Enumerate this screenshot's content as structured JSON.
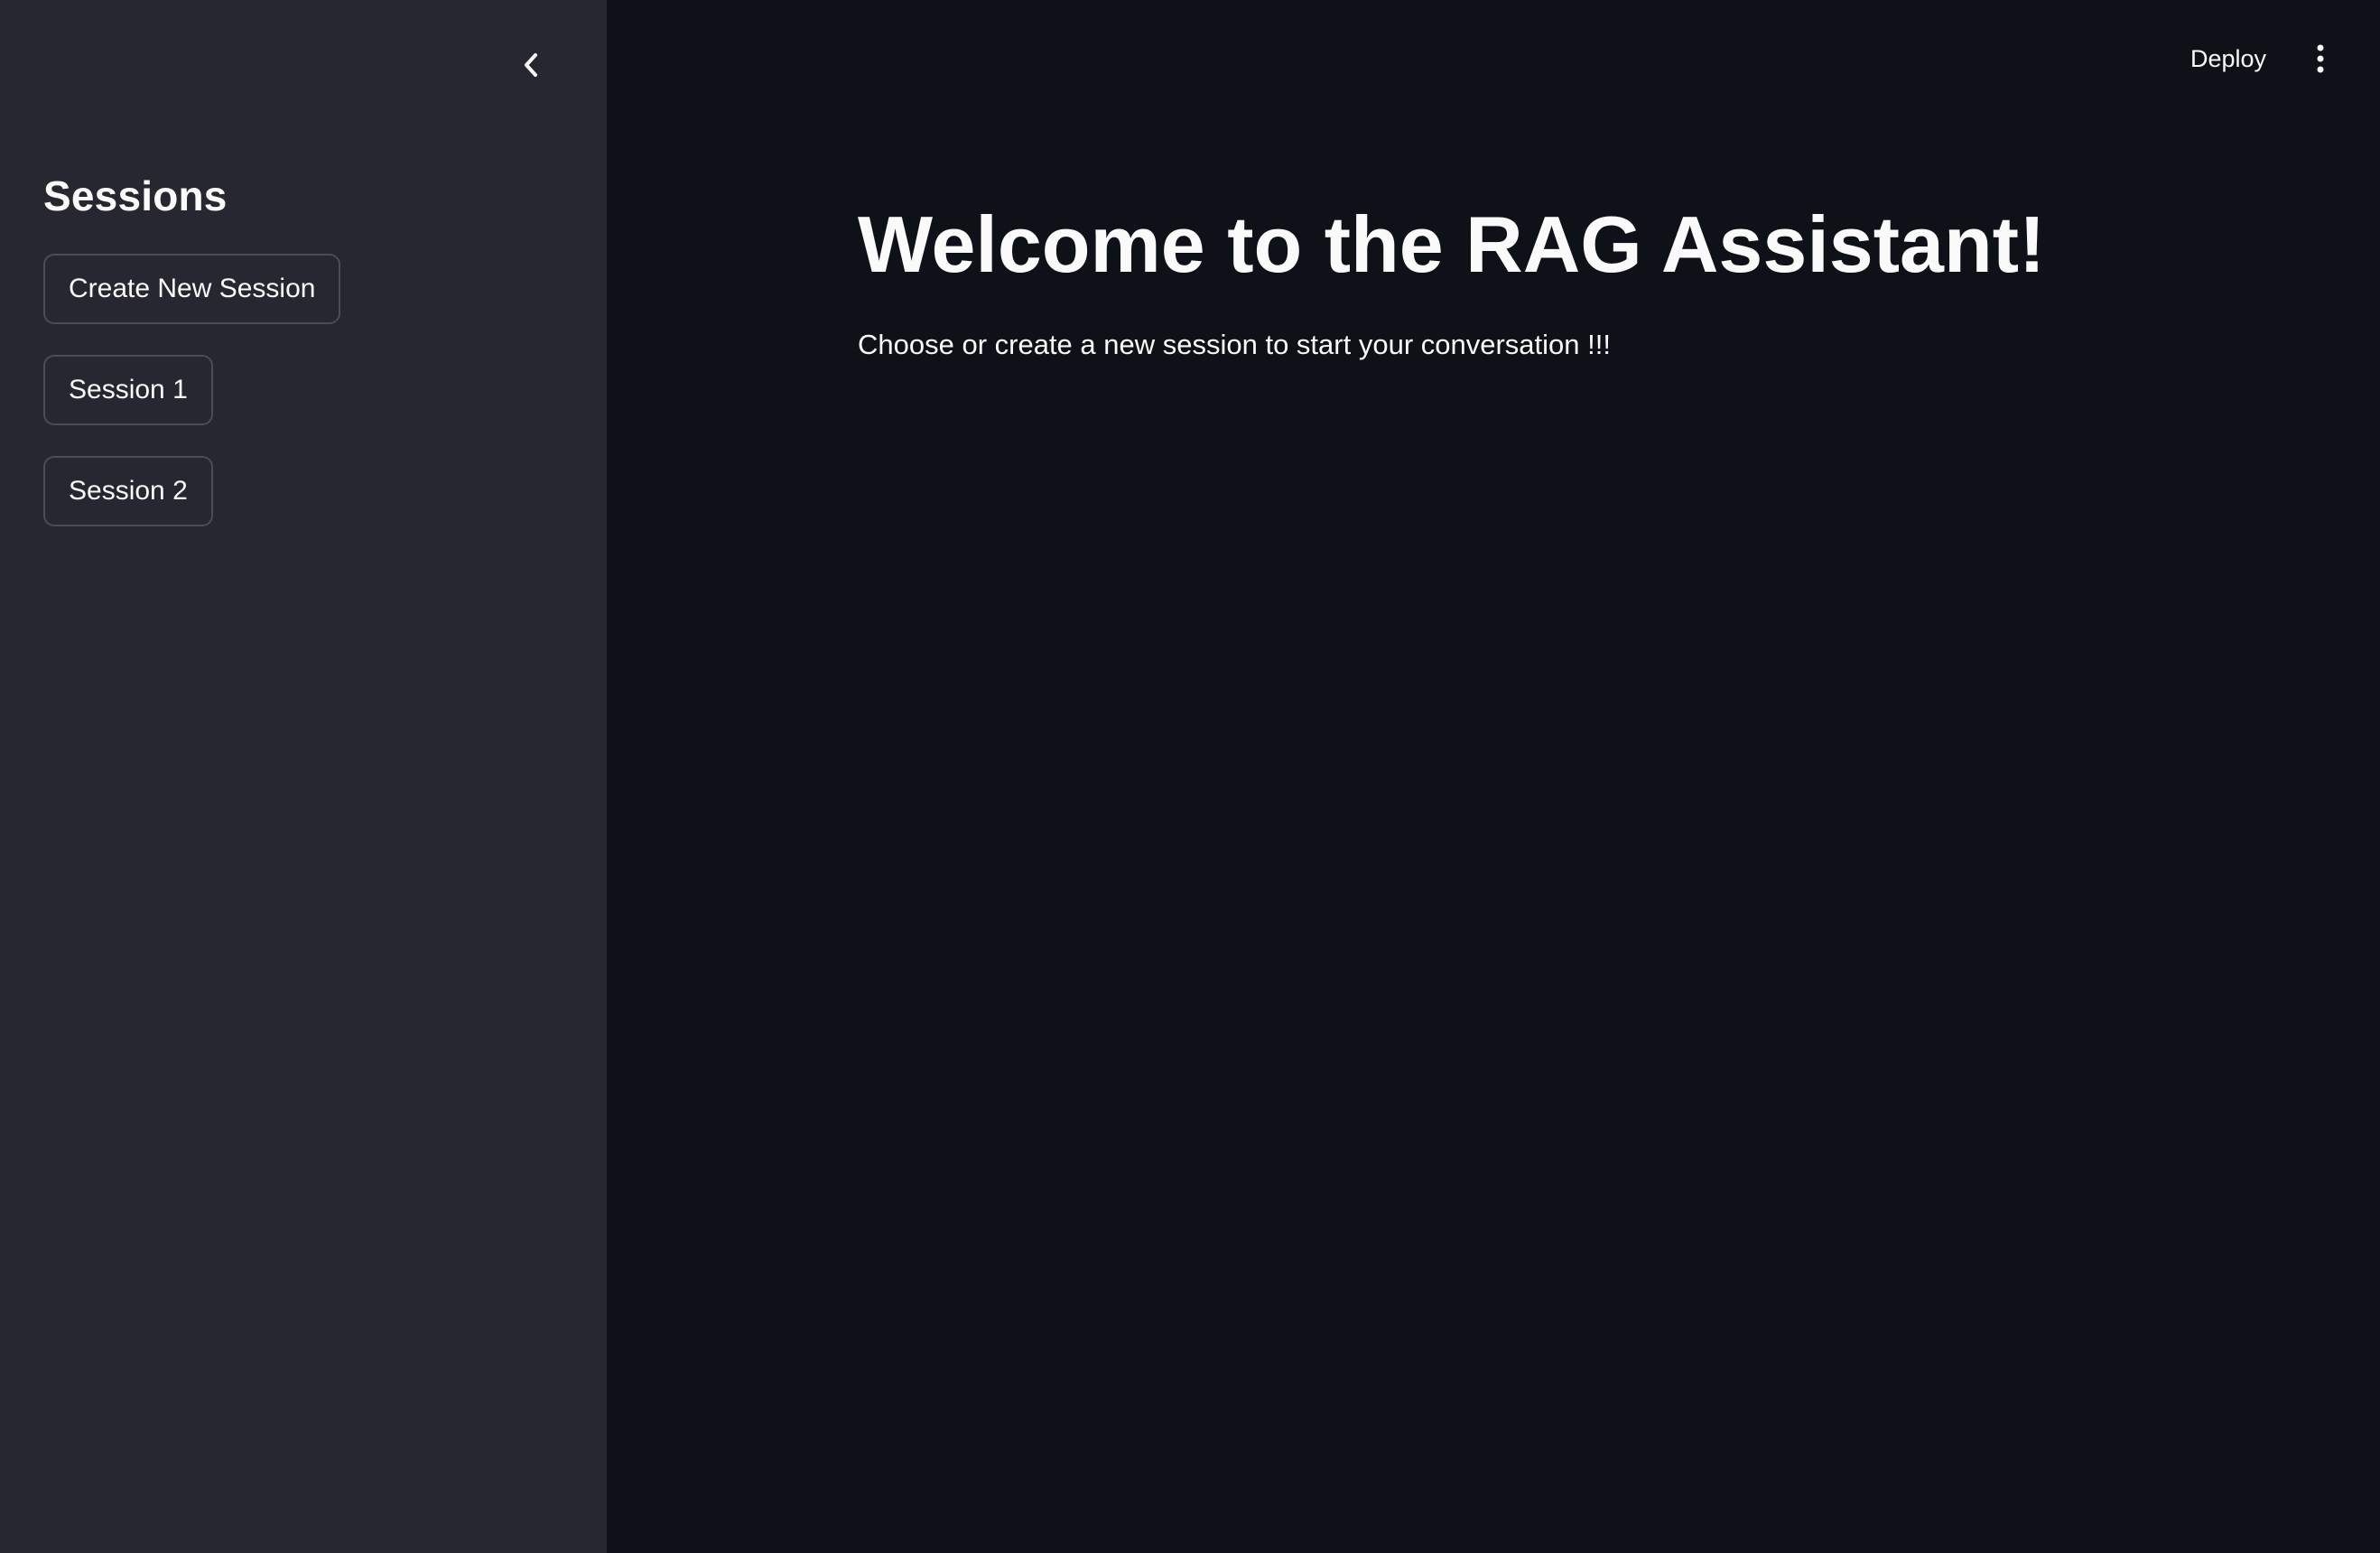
{
  "sidebar": {
    "heading": "Sessions",
    "buttons": {
      "create": "Create New Session",
      "session1": "Session 1",
      "session2": "Session 2"
    },
    "collapse_icon": "chevron-left-icon"
  },
  "header": {
    "deploy_label": "Deploy",
    "menu_icon": "vertical-ellipsis-icon"
  },
  "main": {
    "title": "Welcome to the RAG Assistant!",
    "subtitle": "Choose or create a new session to start your conversation !!!"
  },
  "colors": {
    "sidebar_bg": "#262730",
    "main_bg": "#0e1117",
    "text": "#fafafa",
    "button_border": "#4a4c57"
  }
}
